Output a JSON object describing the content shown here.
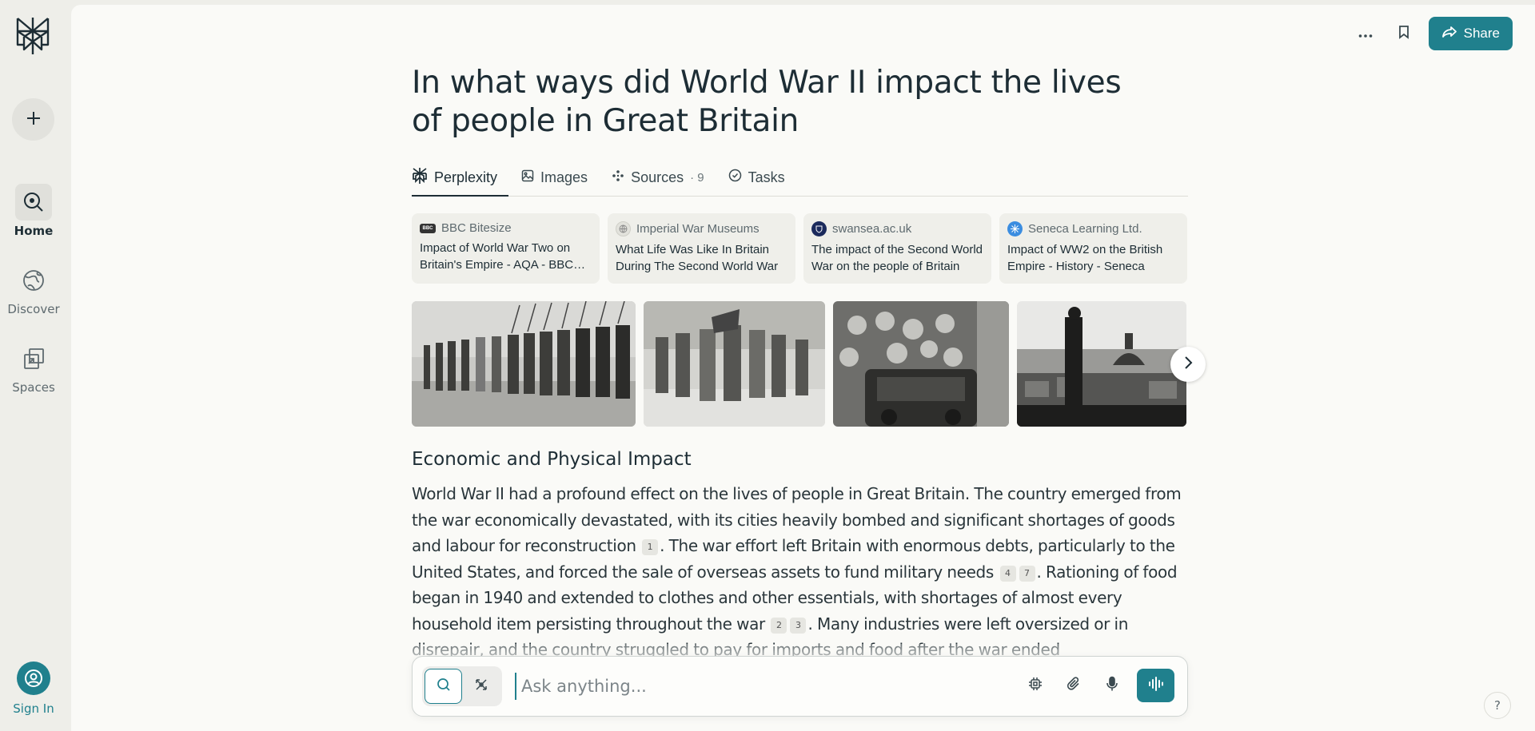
{
  "sidebar": {
    "new_thread_icon": "plus-icon",
    "items": [
      {
        "label": "Home",
        "icon": "search-icon",
        "active": true
      },
      {
        "label": "Discover",
        "icon": "globe-icon",
        "active": false
      },
      {
        "label": "Spaces",
        "icon": "spaces-icon",
        "active": false
      }
    ],
    "sign_in_label": "Sign In"
  },
  "header": {
    "more_icon": "ellipsis-icon",
    "bookmark_icon": "bookmark-icon",
    "share_label": "Share"
  },
  "question": {
    "title": "In what ways did World War II impact the lives of people in Great Britain"
  },
  "tabs": [
    {
      "label": "Perplexity",
      "icon": "perplexity-icon"
    },
    {
      "label": "Images",
      "icon": "image-icon"
    },
    {
      "label": "Sources",
      "icon": "sources-icon",
      "count": "· 9"
    },
    {
      "label": "Tasks",
      "icon": "check-circle-icon"
    }
  ],
  "sources": [
    {
      "site": "BBC Bitesize",
      "title": "Impact of World War Two on Britain's Empire - AQA - BBC Bitesize",
      "favicon_text": "BBC",
      "favicon_color": "#333333"
    },
    {
      "site": "Imperial War Museums",
      "title": "What Life Was Like In Britain During The Second World War",
      "favicon_text": "",
      "favicon_color": "#dadad4"
    },
    {
      "site": "swansea.ac.uk",
      "title": "The impact of the Second World War on the people of Britain",
      "favicon_text": "",
      "favicon_color": "#1b2a5c"
    },
    {
      "site": "Seneca Learning Ltd.",
      "title": "Impact of WW2 on the British Empire - History - Seneca",
      "favicon_text": "",
      "favicon_color": "#3b8de0"
    }
  ],
  "answer": {
    "heading": "Economic and Physical Impact",
    "p1": "World War II had a profound effect on the lives of people in Great Britain. The country emerged from the war economically devastated, with its cities heavily bombed and significant shortages of goods and labour for reconstruction",
    "c1": "1",
    "p2": ". The war effort left Britain with enormous debts, particularly to the United States, and forced the sale of overseas assets to fund military needs",
    "c2a": "4",
    "c2b": "7",
    "p3": ". Rationing of food began in 1940 and extended to clothes and other essentials, with shortages of almost every household item persisting throughout the war",
    "c3a": "2",
    "c3b": "3",
    "p4": ". Many industries were left oversized or in disrepair, and the country struggled to pay for imports and food after the war ended"
  },
  "ask": {
    "placeholder": "Ask anything..."
  },
  "help_label": "?",
  "colors": {
    "accent": "#20808d",
    "background": "#fafaf7",
    "sidebar": "#eeeee9"
  }
}
